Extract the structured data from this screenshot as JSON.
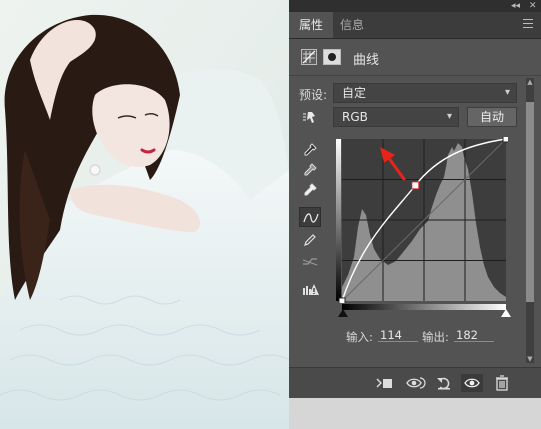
{
  "panel": {
    "tabs": [
      {
        "label": "属性"
      },
      {
        "label": "信息"
      }
    ],
    "collapse_glyph": "◂◂",
    "close_glyph": "✕",
    "header_title": "曲线",
    "preset_label": "预设:",
    "preset_value": "自定",
    "channel_value": "RGB",
    "auto_button": "自动",
    "input_label": "输入:",
    "input_value": "114",
    "output_label": "输出:",
    "output_value": "182"
  },
  "curve": {
    "input": 114,
    "output": 182,
    "axis_max": 255,
    "points": [
      [
        0,
        0
      ],
      [
        114,
        182
      ],
      [
        255,
        255
      ]
    ]
  },
  "icons": {
    "tools": [
      "on-image-adjust-icon",
      "black-eyedropper-icon",
      "gray-eyedropper-icon",
      "white-eyedropper-icon",
      "curve-points-icon",
      "pencil-icon",
      "smooth-icon",
      "clipping-warning-icon"
    ],
    "bottom": [
      "clip-to-layer-icon",
      "view-previous-icon",
      "reset-icon",
      "visibility-eye-icon",
      "trash-icon"
    ]
  },
  "colors": {
    "panel_bg": "#535353",
    "graph_bg": "#3d3d3d",
    "histogram": "#8f8f8f",
    "annotation_arrow": "#e8231a",
    "scroll_thumb": "#8b8b8b"
  }
}
